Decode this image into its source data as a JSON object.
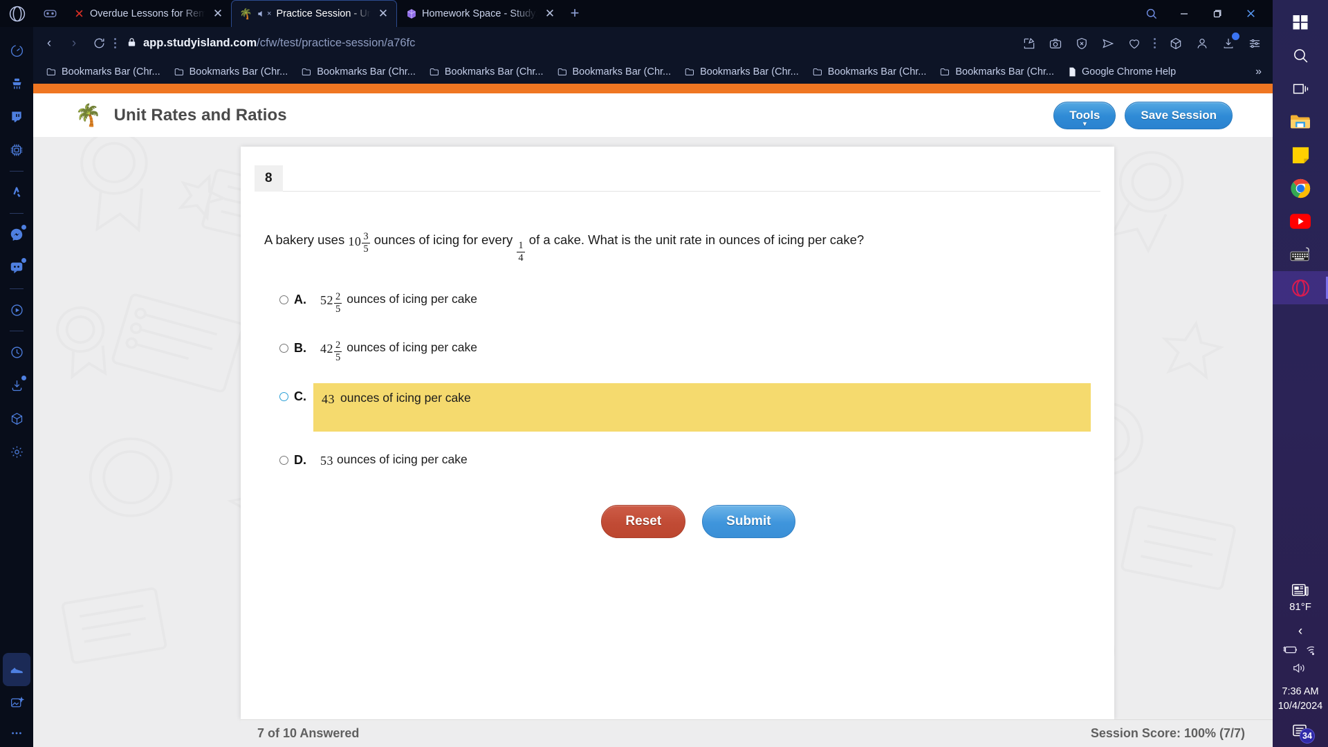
{
  "browser": {
    "name": "opera-gx",
    "tabs": [
      {
        "title": "Overdue Lessons for Remo",
        "favicon": "x-red",
        "active": false,
        "muted": false
      },
      {
        "title": "Practice Session - Unit R",
        "favicon": "palm-tree",
        "active": true,
        "muted": true
      },
      {
        "title": "Homework Space - StudyX",
        "favicon": "cube-purple",
        "active": false,
        "muted": false
      }
    ],
    "new_tab_label": "+",
    "window_controls": {
      "minimize": "─",
      "maximize": "❐",
      "close": "✕"
    },
    "nav": {
      "back": "‹",
      "forward": "›",
      "reload": "⟳"
    },
    "address": {
      "lock_icon": "lock-icon",
      "host": "app.studyisland.com",
      "path": "/cfw/test/practice-session/a76fc"
    },
    "toolbar_icons": [
      "snapshot-icon",
      "camera-icon",
      "shield-x-icon",
      "send-icon",
      "heart-icon",
      "vertical-dots-icon",
      "cube-icon",
      "profile-icon",
      "download-icon",
      "settings-sliders-icon"
    ],
    "bookmarks": {
      "items": [
        "Bookmarks Bar (Chr...",
        "Bookmarks Bar (Chr...",
        "Bookmarks Bar (Chr...",
        "Bookmarks Bar (Chr...",
        "Bookmarks Bar (Chr...",
        "Bookmarks Bar (Chr...",
        "Bookmarks Bar (Chr...",
        "Bookmarks Bar (Chr..."
      ],
      "last": "Google Chrome Help",
      "overflow": "»"
    },
    "sidebar_icons": [
      "speed-dial-icon",
      "cleaner-icon",
      "twitch-icon",
      "gx-control-icon",
      "aria-icon",
      "messenger-icon",
      "discord-icon",
      "player-icon",
      "history-icon",
      "downloads-icon",
      "extensions-icon",
      "settings-icon",
      "sneaker-icon",
      "image-ai-icon",
      "more-icon"
    ]
  },
  "site": {
    "header": {
      "logo": "palm-tree-logo",
      "title": "Unit Rates and Ratios",
      "tools_label": "Tools",
      "save_label": "Save Session"
    },
    "question": {
      "number": "8",
      "prompt_before": "A bakery uses",
      "mixed_1": {
        "whole": "10",
        "num": "3",
        "den": "5"
      },
      "prompt_mid": "ounces of icing for every",
      "frac_2": {
        "num": "1",
        "den": "4"
      },
      "prompt_after": "of a cake. What is the unit rate in ounces of icing per cake?",
      "choices": [
        {
          "letter": "A.",
          "whole": "52",
          "num": "2",
          "den": "5",
          "text": "ounces of icing per cake",
          "selected": false,
          "highlighted": false
        },
        {
          "letter": "B.",
          "whole": "42",
          "num": "2",
          "den": "5",
          "text": "ounces of icing per cake",
          "selected": false,
          "highlighted": false
        },
        {
          "letter": "C.",
          "whole": "43",
          "num": "",
          "den": "",
          "text": "ounces of icing per cake",
          "selected": true,
          "highlighted": true
        },
        {
          "letter": "D.",
          "whole": "53",
          "num": "",
          "den": "",
          "text": "ounces of icing per cake",
          "selected": false,
          "highlighted": false
        }
      ]
    },
    "actions": {
      "reset_label": "Reset",
      "submit_label": "Submit"
    },
    "footer": {
      "progress": "7 of 10 Answered",
      "score": "Session Score: 100% (7/7)"
    },
    "colors": {
      "accent_orange": "#ef7622",
      "highlight_yellow": "#f5da6e",
      "submit_blue": "#3f95dc",
      "reset_red": "#c14b35"
    }
  },
  "taskbar": {
    "icons": [
      "windows-start-icon",
      "search-icon",
      "task-view-icon",
      "file-explorer-icon",
      "sticky-notes-icon",
      "chrome-icon",
      "youtube-icon",
      "on-screen-keyboard-icon",
      "opera-gx-icon"
    ],
    "tray": {
      "weather_icon": "news-weather-icon",
      "temperature": "81°F",
      "chevron": "‹",
      "battery_icon": "battery-charging-icon",
      "wifi_icon": "wifi-icon",
      "volume_icon": "volume-icon",
      "time": "7:36 AM",
      "date": "10/4/2024",
      "notification_icon": "notifications-icon",
      "notification_count": "34"
    }
  }
}
